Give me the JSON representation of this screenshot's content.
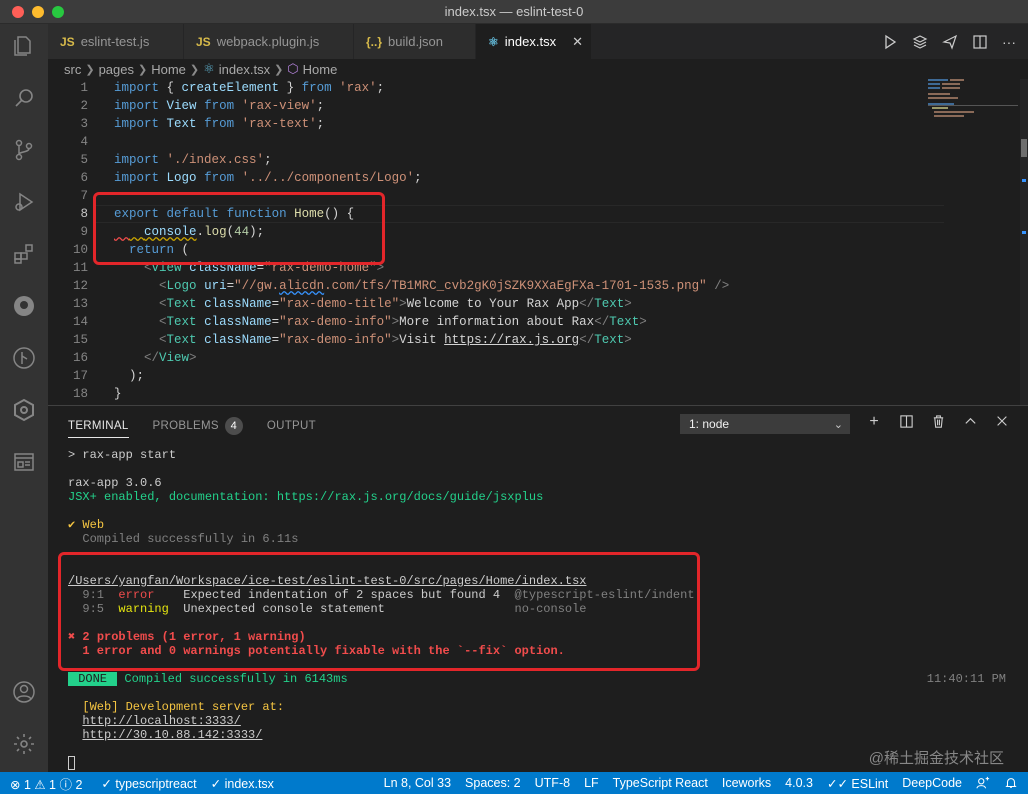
{
  "window": {
    "title": "index.tsx — eslint-test-0"
  },
  "tabs": [
    {
      "icon": "JS",
      "label": "eslint-test.js",
      "icon_color": "#d7ba4a"
    },
    {
      "icon": "JS",
      "label": "webpack.plugin.js",
      "icon_color": "#d7ba4a"
    },
    {
      "icon": "{..}",
      "label": "build.json",
      "icon_color": "#d7ba4a"
    },
    {
      "icon": "⚛",
      "label": "index.tsx",
      "icon_color": "#5fb1ce",
      "close": "✕"
    }
  ],
  "breadcrumb": [
    "src",
    "pages",
    "Home",
    "index.tsx",
    "Home"
  ],
  "editor": {
    "line_numbers": [
      "1",
      "2",
      "3",
      "4",
      "5",
      "6",
      "7",
      "8",
      "9",
      "10",
      "11",
      "12",
      "13",
      "14",
      "15",
      "16",
      "17",
      "18"
    ],
    "tokens": {
      "import": "import",
      "from": "from",
      "export": "export",
      "default": "default",
      "function": "function",
      "return": "return",
      "l1_a": "{ ",
      "l1_b": "createElement",
      "l1_c": " } ",
      "l1_s": "'rax'",
      "semi": ";",
      "l2_v": "View",
      "l2_s": "'rax-view'",
      "l3_v": "Text",
      "l3_s": "'rax-text'",
      "l5_s": "'./index.css'",
      "l6_v": "Logo",
      "l6_s": "'../../components/Logo'",
      "l8_f": "Home",
      "l8_p": "() {",
      "l9_v": "console",
      "l9_dot": ".",
      "l9_f": "log",
      "l9_o": "(",
      "l9_n": "44",
      "l9_c": ");",
      "l10_p": " (",
      "lt": "<",
      "gt": ">",
      "close_lt": "</",
      "eq": "=",
      "selfclose": " />",
      "view": "View",
      "logo": "Logo",
      "text": "Text",
      "className": "className",
      "uri": "uri",
      "l11_s": "\"rax-demo-home\"",
      "l12_s1": "\"//gw.",
      "l12_s2": "alicdn",
      "l12_s3": ".com/tfs/TB1MRC_cvb2gK0jSZK9XXaEgFXa-1701-1535.png\"",
      "l13_s": "\"rax-demo-title\"",
      "l13_t": "Welcome to Your Rax App",
      "l14_s": "\"rax-demo-info\"",
      "l14_t": "More information about Rax",
      "l15_s": "\"rax-demo-info\"",
      "l15_t1": "Visit ",
      "l15_t2": "https://rax.js.org",
      "l17": ");",
      "l18": "}"
    }
  },
  "panel": {
    "tabs": [
      "TERMINAL",
      "PROBLEMS",
      "OUTPUT"
    ],
    "problems_count": "4",
    "terminal_select": "1: node",
    "terminal": {
      "cmd": "> rax-app start",
      "version": "rax-app 3.0.6",
      "jsx": "JSX+ enabled, documentation: https://rax.js.org/docs/guide/jsxplus",
      "web_ok": "✔ Web",
      "compiled": "  Compiled successfully in 6.11s",
      "file": "/Users/yangfan/Workspace/ice-test/eslint-test-0/src/pages/Home/index.tsx",
      "e1_pos": "  9:1  ",
      "e1_sev": "error  ",
      "e1_msg": "  Expected indentation of 2 spaces but found 4  ",
      "e1_rule": "@typescript-eslint/indent",
      "e2_pos": "  9:5  ",
      "e2_sev": "warning",
      "e2_msg": "  Unexpected console statement                  ",
      "e2_rule": "no-console",
      "summary": "✖ 2 problems (1 error, 1 warning)",
      "fixable": "  1 error and 0 warnings potentially fixable with the `--fix` option.",
      "done_badge": " DONE ",
      "done_msg": " Compiled successfully in 6143ms",
      "time": "11:40:11 PM",
      "dev_label": "  [Web] Development server at:",
      "url1": "http://localhost:3333/",
      "url2": "http://30.10.88.142:3333/"
    },
    "watermark": "@稀土掘金技术社区"
  },
  "statusbar": {
    "errors": "⊗ 1 ⚠ 1 ⓘ 2",
    "check1": "✓ typescriptreact",
    "check2": "✓ index.tsx",
    "position": "Ln 8, Col 33",
    "spaces": "Spaces: 2",
    "encoding": "UTF-8",
    "eol": "LF",
    "language": "TypeScript React",
    "iceworks": "Iceworks",
    "version": "4.0.3",
    "eslint": "✓✓ ESLint",
    "deepcode": "DeepCode",
    "colors": {
      "bar": "#007acc"
    }
  },
  "activity_icons": [
    "files-icon",
    "search-icon",
    "source-control-icon",
    "run-debug-icon",
    "extensions-icon",
    "remote-icon",
    "git-graph-icon",
    "iceworks-icon",
    "preview-icon",
    "account-icon",
    "settings-gear-icon"
  ]
}
